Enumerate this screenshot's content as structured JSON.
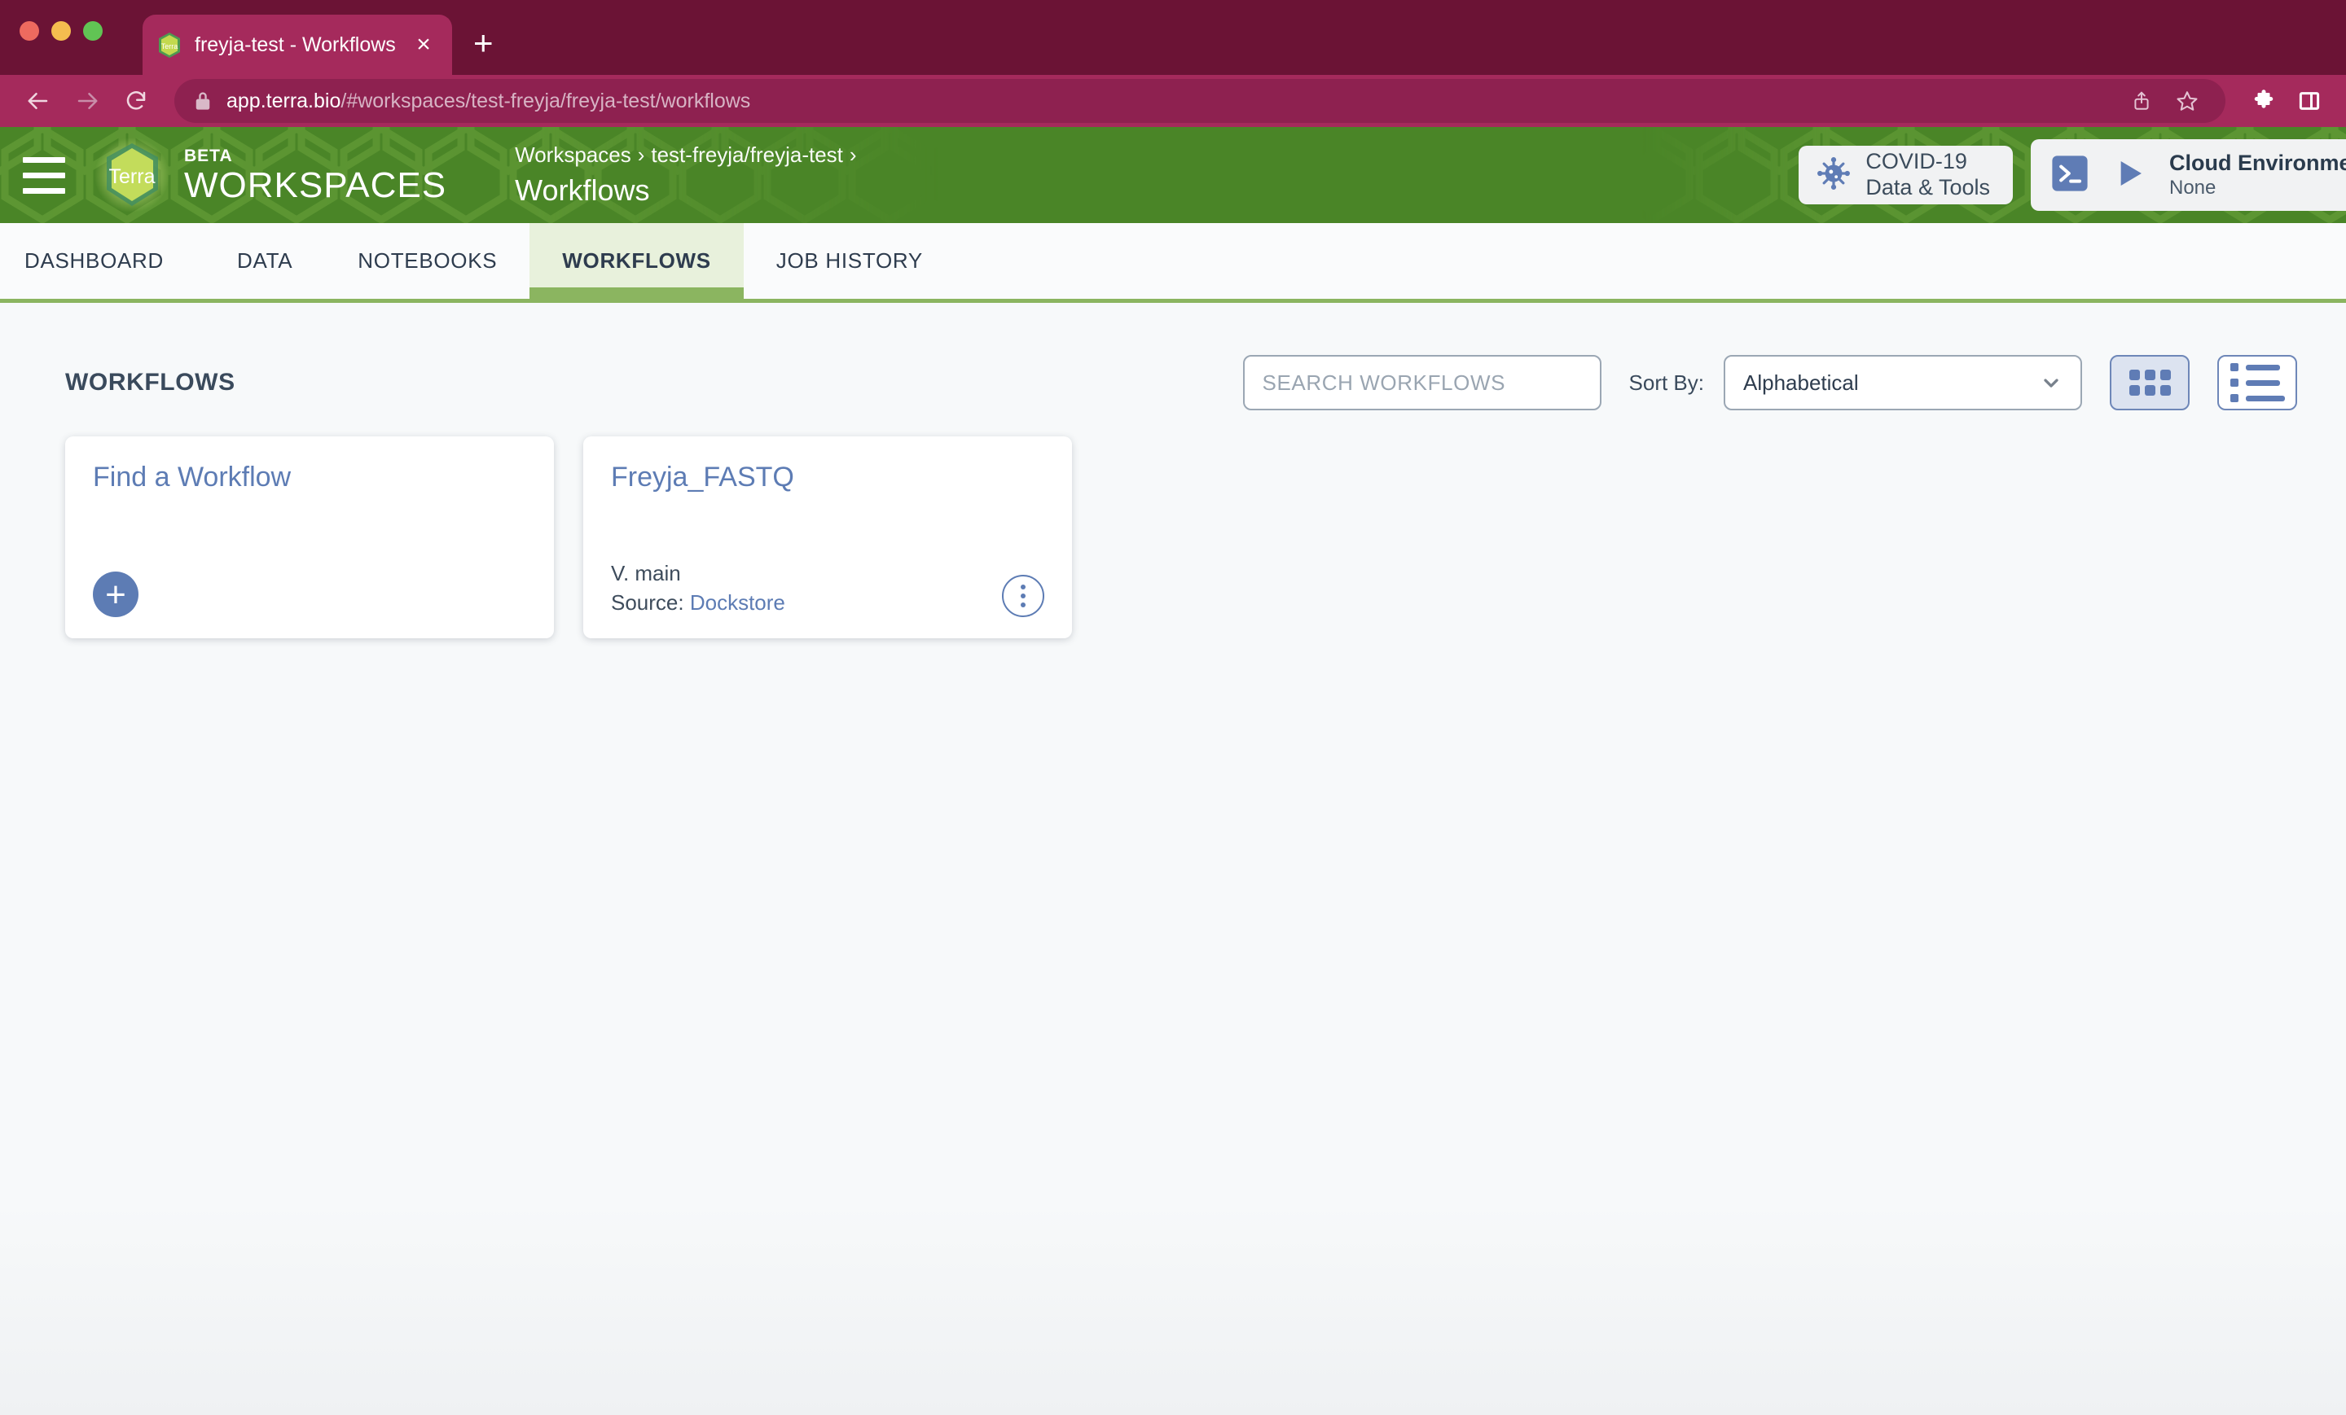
{
  "browser": {
    "tab": {
      "title": "freyja-test - Workflows",
      "favicon_label": "Terra",
      "close_label": "×"
    },
    "new_tab_label": "+",
    "url": {
      "host": "app.terra.bio",
      "path": "/#workspaces/test-freyja/freyja-test/workflows"
    },
    "nav": {
      "back": "back-arrow",
      "forward": "forward-arrow",
      "reload": "reload"
    },
    "actions": [
      "share-icon",
      "bookmark-star-icon",
      "extensions-puzzle-icon",
      "side-panel-icon"
    ]
  },
  "app_header": {
    "menu_icon": "hamburger-menu-icon",
    "logo_text": "Terra",
    "beta_label": "BETA",
    "product_label": "WORKSPACES",
    "breadcrumb": {
      "root": "Workspaces",
      "workspace": "test-freyja/freyja-test",
      "separator": "›"
    },
    "page_title": "Workflows",
    "covid_button": {
      "line1": "COVID-19",
      "line2": "Data & Tools",
      "icon": "virus-icon"
    },
    "cloud_button": {
      "line1": "Cloud Environment",
      "line2": "None",
      "terminal_icon": "terminal-icon",
      "play_icon": "play-triangle-icon"
    }
  },
  "nav_tabs": {
    "items": [
      {
        "label": "DASHBOARD",
        "active": false
      },
      {
        "label": "DATA",
        "active": false
      },
      {
        "label": "NOTEBOOKS",
        "active": false
      },
      {
        "label": "WORKFLOWS",
        "active": true
      },
      {
        "label": "JOB HISTORY",
        "active": false
      }
    ]
  },
  "workflows_page": {
    "section_title": "WORKFLOWS",
    "search": {
      "placeholder": "SEARCH WORKFLOWS",
      "value": ""
    },
    "sort": {
      "label": "Sort By:",
      "selected": "Alphabetical",
      "chevron_icon": "chevron-down-icon"
    },
    "view_toggle": {
      "grid": {
        "icon": "grid-view-icon",
        "active": true
      },
      "list": {
        "icon": "list-view-icon",
        "active": false
      }
    },
    "cards": [
      {
        "kind": "find",
        "title": "Find a Workflow",
        "action_icon": "plus-circle-icon"
      },
      {
        "kind": "workflow",
        "title": "Freyja_FASTQ",
        "version_label": "V. main",
        "source_label": "Source:",
        "source_value": "Dockstore",
        "menu_icon": "kebab-menu-icon"
      }
    ]
  },
  "colors": {
    "browser_chrome": "#6B1335",
    "browser_toolbar": "#A52A5C",
    "terra_green": "#4A8527",
    "tab_accent": "#8BB560",
    "active_tab_bg": "#E8F1DC",
    "link_blue": "#5D7CB4",
    "page_bg": "#F7F9FA",
    "text_dark": "#3A4A5C"
  }
}
